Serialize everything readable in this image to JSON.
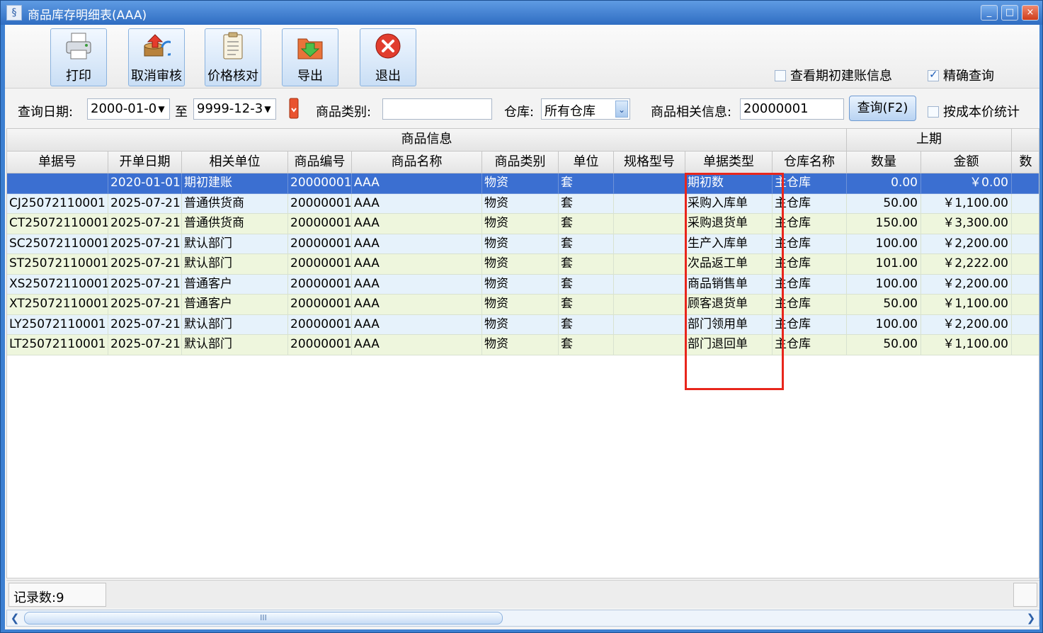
{
  "window": {
    "title": "商品库存明细表(AAA)",
    "controls": [
      "_",
      "□",
      "×"
    ]
  },
  "toolbar": {
    "buttons": [
      {
        "label": "打印",
        "icon": "printer-icon"
      },
      {
        "label": "取消审核",
        "icon": "cancel-audit-icon"
      },
      {
        "label": "价格核对",
        "icon": "clipboard-icon"
      },
      {
        "label": "导出",
        "icon": "export-icon"
      },
      {
        "label": "退出",
        "icon": "close-icon"
      }
    ],
    "check_opening": {
      "label": "查看期初建账信息",
      "checked": false
    },
    "check_exact": {
      "label": "精确查询",
      "checked": true
    }
  },
  "filter": {
    "date_label": "查询日期:",
    "date_from": "2000-01-0",
    "to_label": "至",
    "date_to": "9999-12-3",
    "category_label": "商品类别:",
    "category_value": "",
    "warehouse_label": "仓库:",
    "warehouse_value": "所有仓库",
    "info_label": "商品相关信息:",
    "info_value": "20000001",
    "query_button": "查询(F2)",
    "cost_check": {
      "label": "按成本价统计",
      "checked": false
    }
  },
  "grid": {
    "group_headers": {
      "product_info": "商品信息",
      "previous_period": "上期"
    },
    "columns": [
      "单据号",
      "开单日期",
      "相关单位",
      "商品编号",
      "商品名称",
      "商品类别",
      "单位",
      "规格型号",
      "单据类型",
      "仓库名称",
      "数量",
      "金额",
      "数"
    ],
    "rows": [
      [
        "",
        "2020-01-01",
        "期初建账",
        "20000001",
        "AAA",
        "物资",
        "套",
        "",
        "期初数",
        "主仓库",
        "0.00",
        "￥0.00"
      ],
      [
        "CJ25072110001",
        "2025-07-21",
        "普通供货商",
        "20000001",
        "AAA",
        "物资",
        "套",
        "",
        "采购入库单",
        "主仓库",
        "50.00",
        "￥1,100.00"
      ],
      [
        "CT25072110001",
        "2025-07-21",
        "普通供货商",
        "20000001",
        "AAA",
        "物资",
        "套",
        "",
        "采购退货单",
        "主仓库",
        "150.00",
        "￥3,300.00"
      ],
      [
        "SC25072110001",
        "2025-07-21",
        "默认部门",
        "20000001",
        "AAA",
        "物资",
        "套",
        "",
        "生产入库单",
        "主仓库",
        "100.00",
        "￥2,200.00"
      ],
      [
        "ST25072110001",
        "2025-07-21",
        "默认部门",
        "20000001",
        "AAA",
        "物资",
        "套",
        "",
        "次品返工单",
        "主仓库",
        "101.00",
        "￥2,222.00"
      ],
      [
        "XS25072110001",
        "2025-07-21",
        "普通客户",
        "20000001",
        "AAA",
        "物资",
        "套",
        "",
        "商品销售单",
        "主仓库",
        "100.00",
        "￥2,200.00"
      ],
      [
        "XT25072110001",
        "2025-07-21",
        "普通客户",
        "20000001",
        "AAA",
        "物资",
        "套",
        "",
        "顾客退货单",
        "主仓库",
        "50.00",
        "￥1,100.00"
      ],
      [
        "LY25072110001",
        "2025-07-21",
        "默认部门",
        "20000001",
        "AAA",
        "物资",
        "套",
        "",
        "部门领用单",
        "主仓库",
        "100.00",
        "￥2,200.00"
      ],
      [
        "LT25072110001",
        "2025-07-21",
        "默认部门",
        "20000001",
        "AAA",
        "物资",
        "套",
        "",
        "部门退回单",
        "主仓库",
        "50.00",
        "￥1,100.00"
      ]
    ]
  },
  "status": {
    "record_count": "记录数:9"
  },
  "scroll": {
    "thumb_grip": "III"
  }
}
